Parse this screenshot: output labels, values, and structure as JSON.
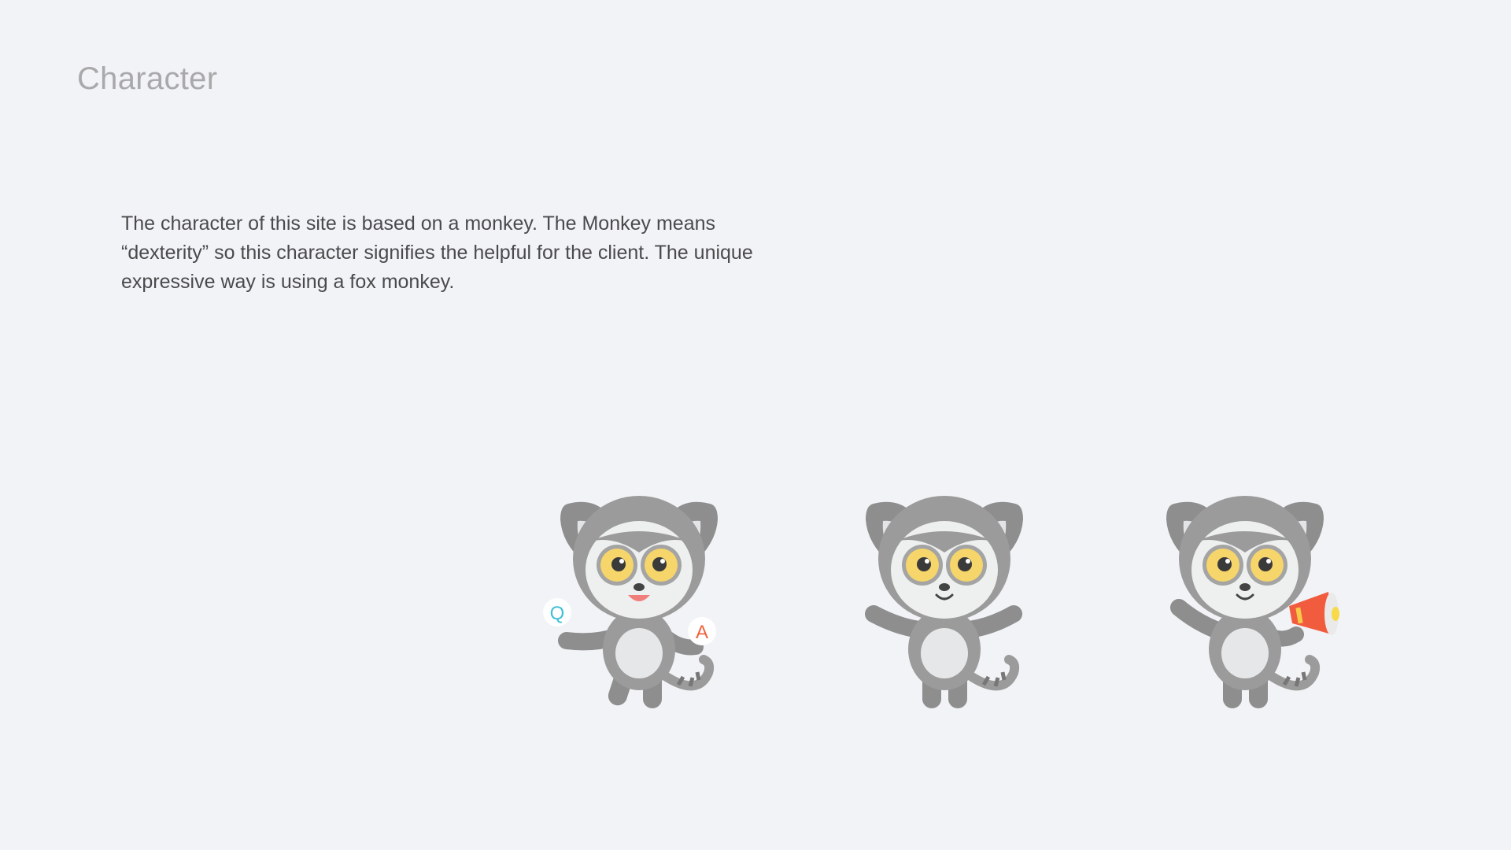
{
  "page": {
    "title": "Character",
    "description": "The character of this site is based on a monkey. The Monkey means\n“dexterity” so this character signifies the helpful for the client. The unique\nexpressive way is using a fox monkey."
  },
  "mascots": [
    {
      "pose": "question-answer",
      "left_badge": "Q",
      "right_badge": "A"
    },
    {
      "pose": "arms-open"
    },
    {
      "pose": "megaphone"
    }
  ],
  "colors": {
    "background": "#f1f3f6",
    "fur": "#9b9b9b",
    "face": "#eef0f0",
    "eye": "#f6d56a",
    "q_badge": "#3fc0d6",
    "a_badge": "#f0643e",
    "megaphone": "#f25c3e",
    "mouth": "#f07f7b"
  }
}
